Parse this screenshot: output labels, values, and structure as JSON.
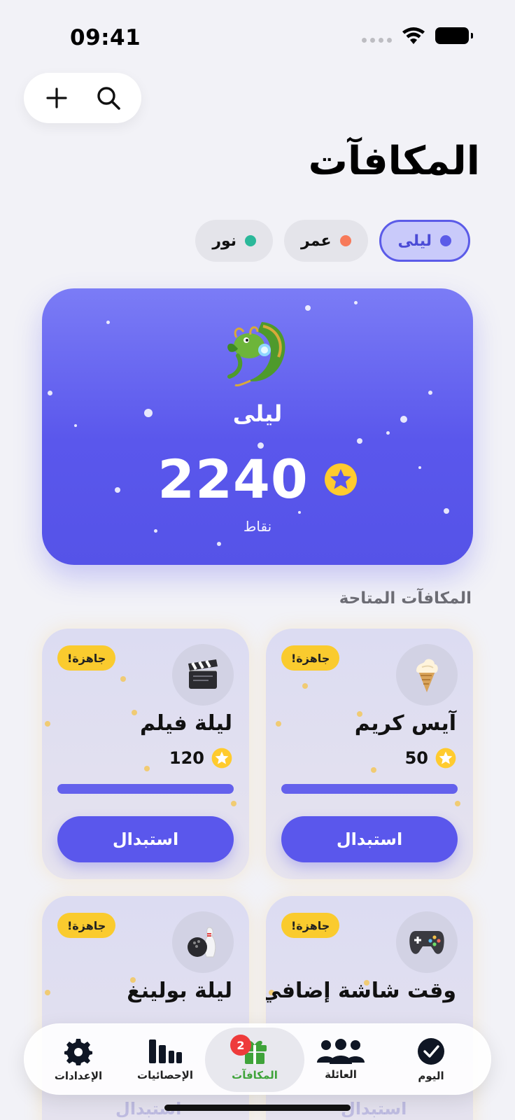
{
  "status_bar": {
    "time": "09:41"
  },
  "page": {
    "title": "المكافآت"
  },
  "members": [
    {
      "name": "ليلى",
      "color": "#5B5BE8",
      "active": true
    },
    {
      "name": "عمر",
      "color": "#F77A5A",
      "active": false
    },
    {
      "name": "نور",
      "color": "#2BB89A",
      "active": false
    }
  ],
  "hero": {
    "name": "ليلى",
    "points": "2240",
    "points_label": "نقاط",
    "avatar_icon": "dragon-icon"
  },
  "section": {
    "available_title": "المكافآت المتاحة"
  },
  "rewards": [
    {
      "title": "آيس كريم",
      "cost": "50",
      "badge": "جاهزة!",
      "button": "استبدال",
      "icon": "ice-cream-icon",
      "progress": 1.0
    },
    {
      "title": "ليلة فيلم",
      "cost": "120",
      "badge": "جاهزة!",
      "button": "استبدال",
      "icon": "clapper-icon",
      "progress": 1.0
    },
    {
      "title": "وقت شاشة إضافي",
      "badge": "جاهزة!",
      "icon": "game-controller-icon"
    },
    {
      "title": "ليلة بولينغ",
      "badge": "جاهزة!",
      "icon": "bowling-icon"
    }
  ],
  "peek": {
    "button": "استبدال"
  },
  "tabbar": {
    "today": "اليوم",
    "family": "العائلة",
    "rewards": "المكافآت",
    "rewards_badge": "2",
    "stats": "الإحصائيات",
    "settings": "الإعدادات",
    "active_color": "#3FA33A"
  }
}
